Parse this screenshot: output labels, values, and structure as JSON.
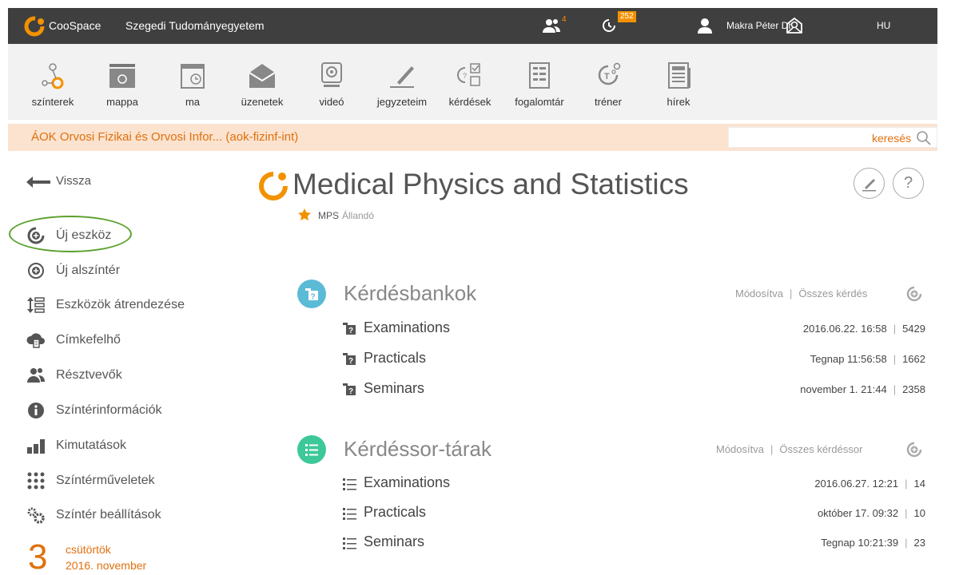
{
  "topbar": {
    "brand": "CooSpace",
    "university": "Szegedi Tudományegyetem",
    "people_count": "4",
    "clock_badge": "252",
    "user": "Makra Péter Dr.",
    "language": "HU"
  },
  "toolbar": [
    {
      "label": "színterek",
      "icon": "spaces-icon"
    },
    {
      "label": "mappa",
      "icon": "folder-icon"
    },
    {
      "label": "ma",
      "icon": "calendar-today-icon"
    },
    {
      "label": "üzenetek",
      "icon": "messages-icon"
    },
    {
      "label": "videó",
      "icon": "video-icon"
    },
    {
      "label": "jegyzeteim",
      "icon": "notes-icon"
    },
    {
      "label": "kérdések",
      "icon": "questions-icon"
    },
    {
      "label": "fogalomtár",
      "icon": "glossary-icon"
    },
    {
      "label": "tréner",
      "icon": "trainer-icon"
    },
    {
      "label": "hírek",
      "icon": "news-icon"
    }
  ],
  "course": {
    "title": "ÁOK Orvosi Fizikai és Orvosi Infor... (aok-fizinf-int)",
    "search_label": "keresés"
  },
  "sidebar": {
    "back": "Vissza",
    "items": [
      {
        "label": "Új eszköz",
        "icon": "add-tool-icon"
      },
      {
        "label": "Új alszíntér",
        "icon": "add-subspace-icon"
      },
      {
        "label": "Eszközök átrendezése",
        "icon": "reorder-icon"
      },
      {
        "label": "Címkefelhő",
        "icon": "tag-cloud-icon"
      },
      {
        "label": "Résztvevők",
        "icon": "participants-icon"
      },
      {
        "label": "Színtérinformációk",
        "icon": "info-icon"
      },
      {
        "label": "Kimutatások",
        "icon": "statistics-icon"
      },
      {
        "label": "Színtérműveletek",
        "icon": "operations-icon"
      },
      {
        "label": "Színtér beállítások",
        "icon": "settings-icon"
      }
    ],
    "date": {
      "day_number": "3",
      "weekday": "csütörtök",
      "month": "2016. november"
    }
  },
  "main": {
    "title": "Medical Physics and Statistics",
    "code": "MPS",
    "status": "Állandó",
    "sections": [
      {
        "title": "Kérdésbankok",
        "meta_modified": "Módosítva",
        "meta_all": "Összes kérdés",
        "color": "#5bbbd6",
        "rows": [
          {
            "name": "Examinations",
            "date": "2016.06.22. 16:58",
            "count": "5429"
          },
          {
            "name": "Practicals",
            "date": "Tegnap 11:56:58",
            "count": "1662"
          },
          {
            "name": "Seminars",
            "date": "november 1. 21:44",
            "count": "2358"
          }
        ]
      },
      {
        "title": "Kérdéssor-tárak",
        "meta_modified": "Módosítva",
        "meta_all": "Összes kérdéssor",
        "color": "#3dc89a",
        "rows": [
          {
            "name": "Examinations",
            "date": "2016.06.27. 12:21",
            "count": "14"
          },
          {
            "name": "Practicals",
            "date": "október 17. 09:32",
            "count": "10"
          },
          {
            "name": "Seminars",
            "date": "Tegnap 10:21:39",
            "count": "23"
          }
        ]
      }
    ]
  },
  "colors": {
    "accent": "#e0700d",
    "topbar": "#3f3f3f",
    "highlight": "#5aa02c"
  }
}
